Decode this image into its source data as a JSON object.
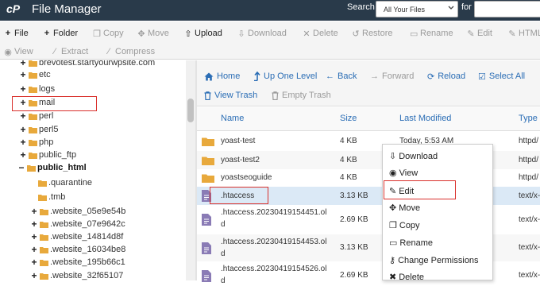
{
  "header": {
    "logo": "cP",
    "title": "File Manager",
    "search_label": "Search",
    "search_scope": "All Your Files",
    "for_label": "for"
  },
  "toolbar": {
    "file": "File",
    "folder": "Folder",
    "copy": "Copy",
    "move": "Move",
    "upload": "Upload",
    "download": "Download",
    "delete": "Delete",
    "restore": "Restore",
    "rename": "Rename",
    "edit": "Edit",
    "html_editor": "HTML",
    "view": "View",
    "extract": "Extract",
    "compress": "Compress"
  },
  "tree": {
    "items": [
      {
        "label": "brevotest.startyourwpsite.com",
        "toggle": "+"
      },
      {
        "label": "etc",
        "toggle": "+"
      },
      {
        "label": "logs",
        "toggle": "+"
      },
      {
        "label": "mail",
        "toggle": "+"
      },
      {
        "label": "perl",
        "toggle": "+"
      },
      {
        "label": "perl5",
        "toggle": "+"
      },
      {
        "label": "php",
        "toggle": "+"
      },
      {
        "label": "public_ftp",
        "toggle": "+"
      },
      {
        "label": "public_html",
        "toggle": "−"
      },
      {
        "label": ".quarantine",
        "toggle": ""
      },
      {
        "label": ".tmb",
        "toggle": ""
      },
      {
        "label": ".website_05e9e54b",
        "toggle": "+"
      },
      {
        "label": ".website_07e9642c",
        "toggle": "+"
      },
      {
        "label": ".website_14814d8f",
        "toggle": "+"
      },
      {
        "label": ".website_16034be8",
        "toggle": "+"
      },
      {
        "label": ".website_195b66c1",
        "toggle": "+"
      },
      {
        "label": ".website_32f65107",
        "toggle": "+"
      }
    ]
  },
  "nav": {
    "home": "Home",
    "up": "Up One Level",
    "back": "Back",
    "forward": "Forward",
    "reload": "Reload",
    "select_all": "Select All",
    "view_trash": "View Trash",
    "empty_trash": "Empty Trash"
  },
  "table": {
    "headers": {
      "name": "Name",
      "size": "Size",
      "modified": "Last Modified",
      "type": "Type"
    },
    "rows": [
      {
        "name": "yoast-test",
        "size": "4 KB",
        "modified": "Today, 5:53 AM",
        "type": "httpd/"
      },
      {
        "name": "yoast-test2",
        "size": "4 KB",
        "modified": "",
        "type": "httpd/"
      },
      {
        "name": "yoastseoguide",
        "size": "4 KB",
        "modified": "",
        "type": "httpd/"
      },
      {
        "name": ".htaccess",
        "size": "3.13 KB",
        "modified": "",
        "type": "text/x-"
      },
      {
        "name1": ".htaccess.20230419154451.ol",
        "name2": "d",
        "size": "2.69 KB",
        "modified": "",
        "type": "text/x-"
      },
      {
        "name1": ".htaccess.20230419154453.ol",
        "name2": "d",
        "size": "3.13 KB",
        "modified": "",
        "type": "text/x-"
      },
      {
        "name1": ".htaccess.20230419154526.ol",
        "name2": "d",
        "size": "2.69 KB",
        "modified": "",
        "type": "text/x-"
      }
    ]
  },
  "context_menu": {
    "download": "Download",
    "view": "View",
    "edit": "Edit",
    "move": "Move",
    "copy": "Copy",
    "rename": "Rename",
    "change_permissions": "Change Permissions",
    "delete": "Delete"
  },
  "colors": {
    "header": "#293a4a",
    "link": "#2a6db5",
    "folder": "#e8a93c",
    "highlight": "#d9302c",
    "selected_row": "#dbe9f6"
  }
}
